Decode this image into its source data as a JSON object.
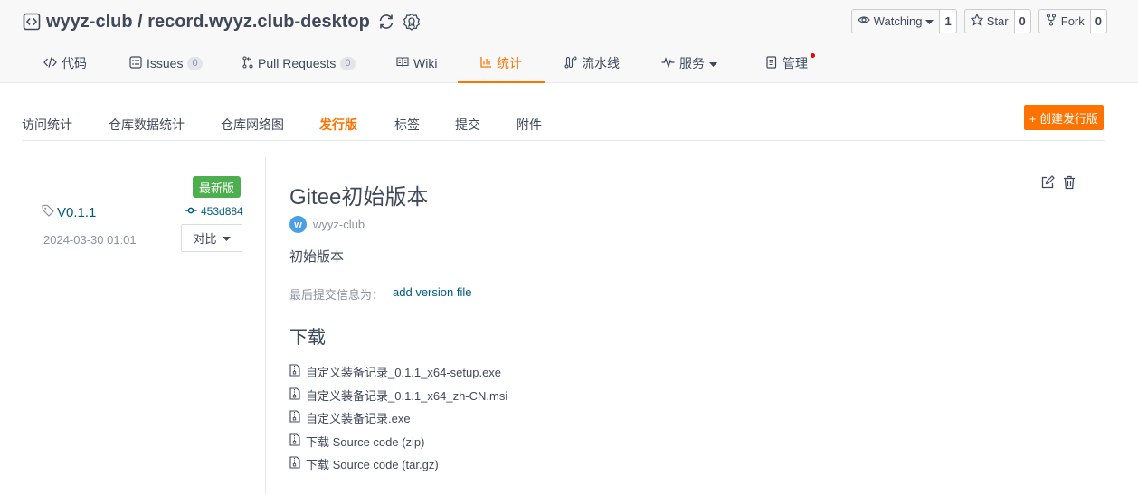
{
  "repo": {
    "title": "wyyz-club / record.wyyz.club-desktop"
  },
  "actions": {
    "watching": {
      "label": "Watching",
      "count": "1"
    },
    "star": {
      "label": "Star",
      "count": "0"
    },
    "fork": {
      "label": "Fork",
      "count": "0"
    }
  },
  "tabs": [
    {
      "label": "代码"
    },
    {
      "label": "Issues",
      "count": "0"
    },
    {
      "label": "Pull Requests",
      "count": "0"
    },
    {
      "label": "Wiki"
    },
    {
      "label": "统计"
    },
    {
      "label": "流水线"
    },
    {
      "label": "服务"
    },
    {
      "label": "管理"
    }
  ],
  "active_tab": "统计",
  "subnav": [
    {
      "label": "访问统计"
    },
    {
      "label": "仓库数据统计"
    },
    {
      "label": "仓库网络图"
    },
    {
      "label": "发行版"
    },
    {
      "label": "标签"
    },
    {
      "label": "提交"
    },
    {
      "label": "附件"
    }
  ],
  "create_release_label": "+ 创建发行版",
  "release": {
    "latest_badge": "最新版",
    "tag": "V0.1.1",
    "commit": "453d884",
    "date": "2024-03-30 01:01",
    "compare_label": "对比",
    "title": "Gitee初始版本",
    "author_initial": "w",
    "author": "wyyz-club",
    "description": "初始版本",
    "commit_label": "最后提交信息为：",
    "commit_message": "add version file",
    "download_heading": "下载",
    "downloads": [
      "自定义装备记录_0.1.1_x64-setup.exe",
      "自定义装备记录_0.1.1_x64_zh-CN.msi",
      "自定义装备记录.exe",
      "下载 Source code (zip)",
      "下载 Source code (tar.gz)"
    ]
  },
  "colors": {
    "accent": "#fe7300",
    "link": "#005980",
    "latest_badge": "#4cae4c",
    "text": "#40485b",
    "muted": "#8c92a4"
  }
}
